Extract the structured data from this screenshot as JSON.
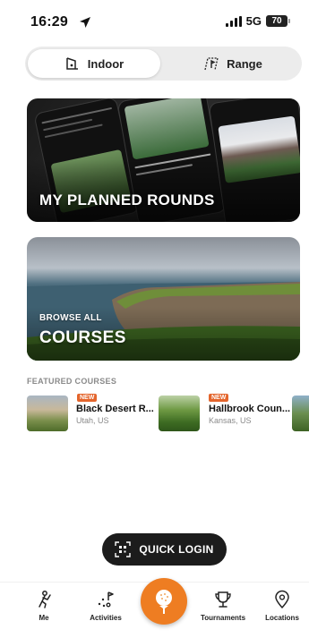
{
  "status_bar": {
    "time": "16:29",
    "network": "5G",
    "battery": "70"
  },
  "segmented": {
    "indoor_label": "Indoor",
    "range_label": "Range",
    "selected": "Indoor"
  },
  "cards": {
    "planned_title": "MY PLANNED ROUNDS",
    "courses_subtitle": "BROWSE ALL",
    "courses_title": "COURSES"
  },
  "featured": {
    "heading": "FEATURED COURSES",
    "items": [
      {
        "badge": "NEW",
        "name": "Black Desert R...",
        "location": "Utah, US"
      },
      {
        "badge": "NEW",
        "name": "Hallbrook Coun...",
        "location": "Kansas, US"
      }
    ]
  },
  "quick_login": {
    "label": "QUICK LOGIN"
  },
  "nav": {
    "items": [
      {
        "label": "Me",
        "icon": "golfer-icon"
      },
      {
        "label": "Activities",
        "icon": "activities-icon"
      },
      {
        "label": "",
        "icon": "golf-ball-tee-icon"
      },
      {
        "label": "Tournaments",
        "icon": "trophy-icon"
      },
      {
        "label": "Locations",
        "icon": "location-pin-icon"
      }
    ]
  },
  "colors": {
    "accent": "#ee7d22",
    "badge": "#e4652c",
    "dark_button": "#1c1c1c"
  }
}
